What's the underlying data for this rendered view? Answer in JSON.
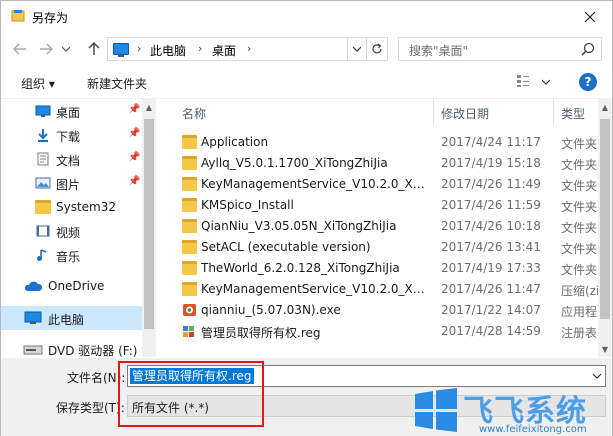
{
  "window": {
    "title": "另存为"
  },
  "address_bar": {
    "parts": [
      "此电脑",
      "桌面"
    ],
    "search_placeholder": "搜索\"桌面\""
  },
  "toolbar": {
    "organize": "组织 ▾",
    "new_folder": "新建文件夹"
  },
  "nav_pane": {
    "items": [
      {
        "label": "桌面",
        "icon": "desktop-icon",
        "pinned": true
      },
      {
        "label": "下载",
        "icon": "download-icon",
        "pinned": true
      },
      {
        "label": "文档",
        "icon": "document-icon",
        "pinned": true
      },
      {
        "label": "图片",
        "icon": "picture-icon",
        "pinned": true
      },
      {
        "label": "System32",
        "icon": "folder-icon",
        "pinned": false
      },
      {
        "label": "视频",
        "icon": "video-icon",
        "pinned": false
      },
      {
        "label": "音乐",
        "icon": "music-icon",
        "pinned": false
      },
      {
        "label": "OneDrive",
        "icon": "cloud-icon",
        "pinned": false
      },
      {
        "label": "此电脑",
        "icon": "computer-icon",
        "pinned": false,
        "selected": true
      },
      {
        "label": "DVD 驱动器 (F:) (",
        "icon": "dvd-icon",
        "pinned": false
      }
    ]
  },
  "file_list": {
    "headers": {
      "name": "名称",
      "date": "修改日期",
      "type": "类型"
    },
    "rows": [
      {
        "name": "Application",
        "date": "2017/4/24 11:17",
        "type": "文件夹",
        "icon": "folder-icon"
      },
      {
        "name": "Ayllq_V5.0.1.1700_XiTongZhiJia",
        "date": "2017/4/19 15:18",
        "type": "文件夹",
        "icon": "folder-icon"
      },
      {
        "name": "KeyManagementService_V10.2.0_Xito...",
        "date": "2017/4/26 11:49",
        "type": "文件夹",
        "icon": "folder-icon"
      },
      {
        "name": "KMSpico_Install",
        "date": "2017/4/26 11:59",
        "type": "文件夹",
        "icon": "folder-icon"
      },
      {
        "name": "QianNiu_V3.05.05N_XiTongZhiJia",
        "date": "2017/4/26 10:18",
        "type": "文件夹",
        "icon": "folder-icon"
      },
      {
        "name": "SetACL (executable version)",
        "date": "2017/4/26 13:41",
        "type": "文件夹",
        "icon": "folder-icon"
      },
      {
        "name": "TheWorld_6.2.0.128_XiTongZhiJia",
        "date": "2017/4/19 17:33",
        "type": "文件夹",
        "icon": "folder-icon"
      },
      {
        "name": "KeyManagementService_V10.2.0_Xito...",
        "date": "2017/4/26 11:47",
        "type": "压缩(zip",
        "icon": "zip-icon"
      },
      {
        "name": "qianniu_(5.07.03N).exe",
        "date": "2017/1/22 14:07",
        "type": "应用程",
        "icon": "exe-icon"
      },
      {
        "name": "管理员取得所有权.reg",
        "date": "2017/4/28 14:59",
        "type": "注册表",
        "icon": "reg-icon"
      }
    ]
  },
  "bottom": {
    "filename_label": "文件名(N):",
    "filename_value": "管理员取得所有权.reg",
    "filetype_label": "保存类型(T):",
    "filetype_value": "所有文件  (*.*)"
  },
  "watermark": {
    "text": "飞飞系统",
    "url": "www.feifeixitong.com"
  },
  "colors": {
    "accent": "#0078d7",
    "selection": "#cce8ff",
    "highlight_border": "#e0171c",
    "folder": "#f4c747"
  }
}
